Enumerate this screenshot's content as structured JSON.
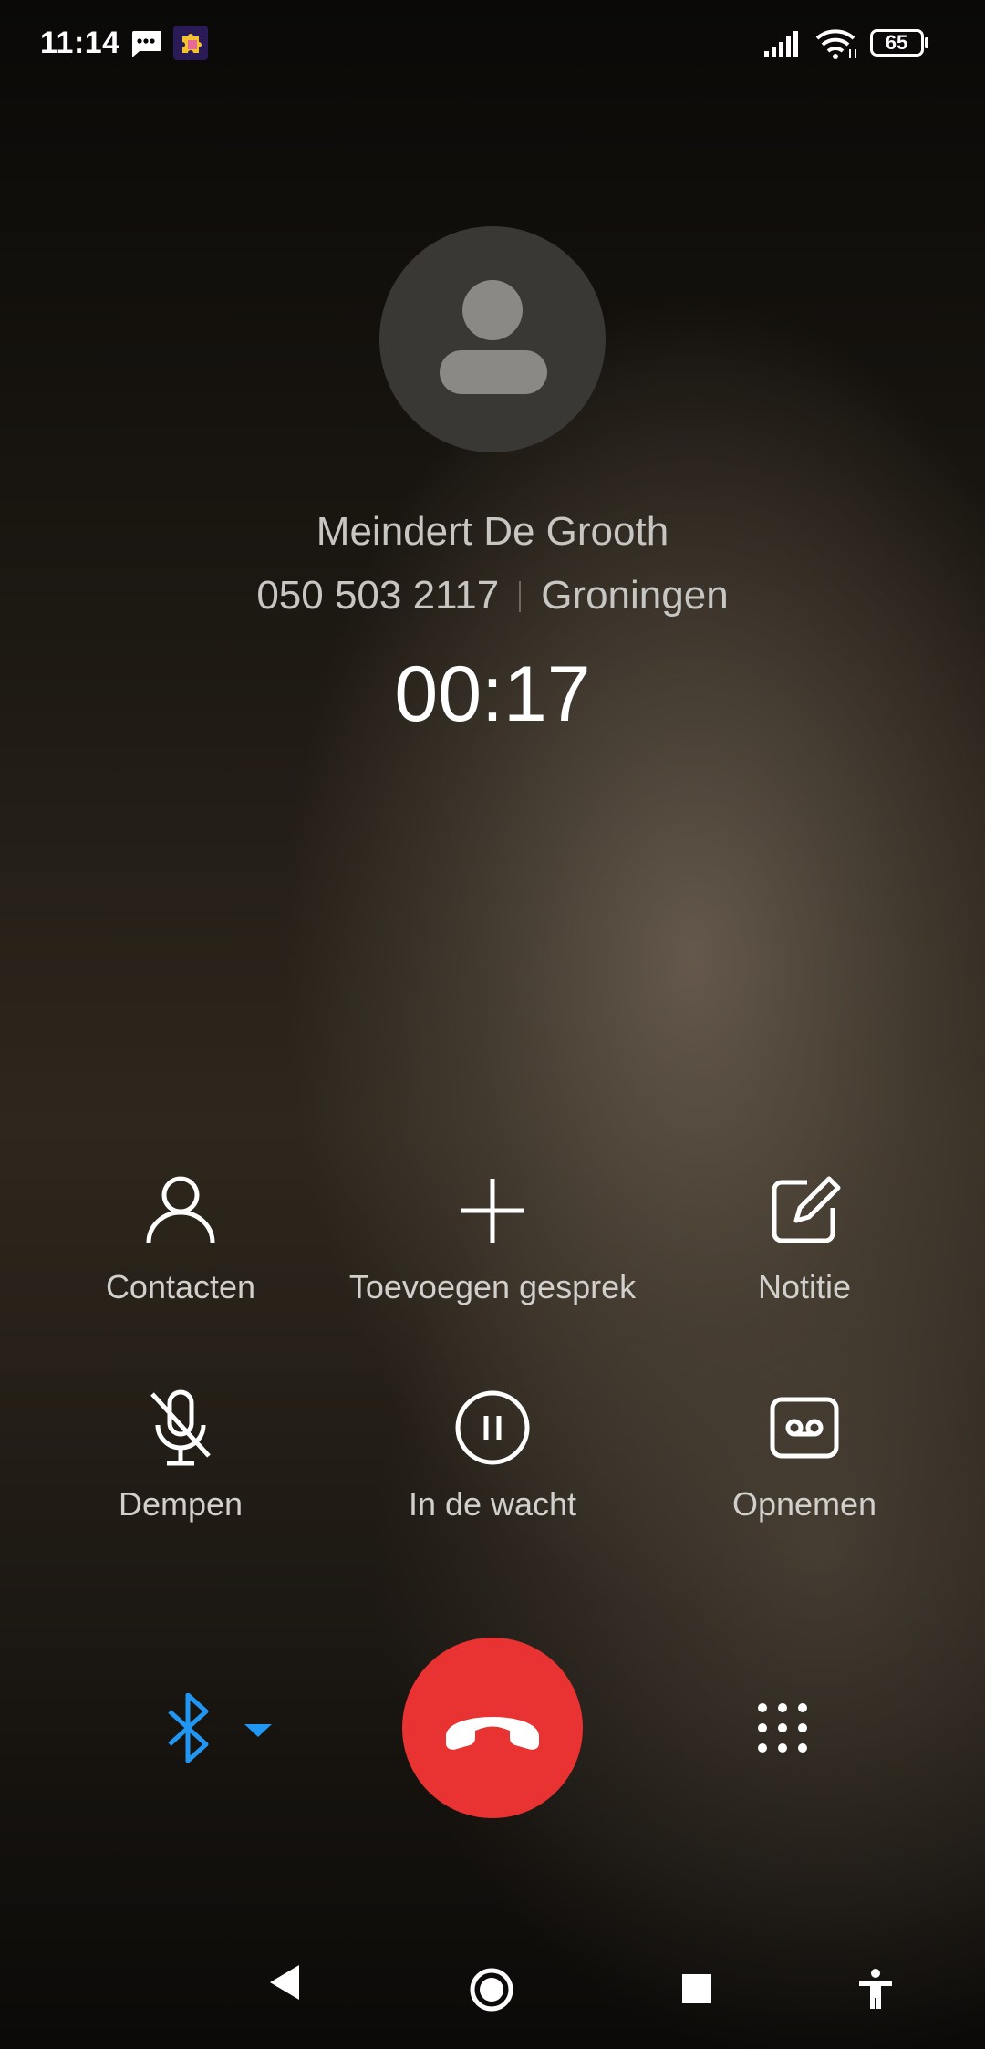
{
  "status_bar": {
    "time": "11:14",
    "battery": "65",
    "icons": [
      "message-icon",
      "puzzle-app-icon",
      "signal-icon",
      "wifi-icon",
      "battery-icon"
    ]
  },
  "caller": {
    "name": "Meindert De Grooth",
    "number": "050 503 2117",
    "location": "Groningen",
    "duration": "00:17"
  },
  "actions": {
    "contacts": "Contacten",
    "add_call": "Toevoegen gesprek",
    "note": "Notitie",
    "mute": "Dempen",
    "hold": "In de wacht",
    "record": "Opnemen"
  },
  "controls": {
    "audio_route_icon": "bluetooth-icon",
    "end_call_icon": "phone-hangup-icon",
    "dialpad_icon": "dialpad-icon"
  },
  "nav": {
    "icons": [
      "back-icon",
      "home-icon",
      "recents-icon",
      "accessibility-icon"
    ]
  },
  "colors": {
    "end_call": "#e93232",
    "bluetooth": "#2196f3"
  }
}
